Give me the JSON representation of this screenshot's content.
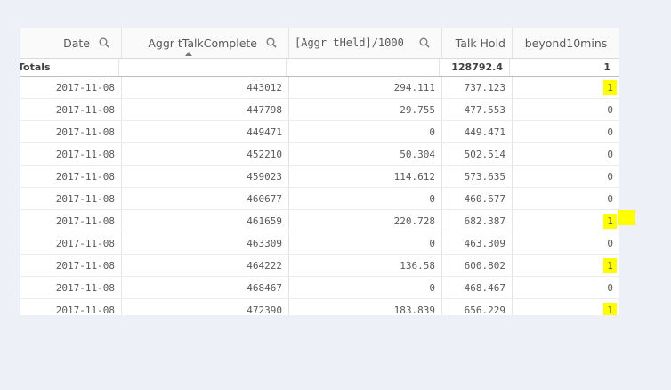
{
  "headers": {
    "date": "Date",
    "talk_complete": "Aggr tTalkComplete",
    "held": "[Aggr tHeld]/1000",
    "talk_hold": "Talk Hold",
    "beyond": "beyond10mins"
  },
  "totals": {
    "label": "Totals",
    "date": "",
    "talk_complete": "",
    "held": "",
    "talk_hold": "128792.4",
    "beyond": "1"
  },
  "rows": [
    {
      "date": "2017-11-08",
      "talk_complete": "443012",
      "held": "294.111",
      "talk_hold": "737.123",
      "beyond": "1",
      "highlight": true
    },
    {
      "date": "2017-11-08",
      "talk_complete": "447798",
      "held": "29.755",
      "talk_hold": "477.553",
      "beyond": "0",
      "highlight": false
    },
    {
      "date": "2017-11-08",
      "talk_complete": "449471",
      "held": "0",
      "talk_hold": "449.471",
      "beyond": "0",
      "highlight": false
    },
    {
      "date": "2017-11-08",
      "talk_complete": "452210",
      "held": "50.304",
      "talk_hold": "502.514",
      "beyond": "0",
      "highlight": false
    },
    {
      "date": "2017-11-08",
      "talk_complete": "459023",
      "held": "114.612",
      "talk_hold": "573.635",
      "beyond": "0",
      "highlight": false
    },
    {
      "date": "2017-11-08",
      "talk_complete": "460677",
      "held": "0",
      "talk_hold": "460.677",
      "beyond": "0",
      "highlight": false
    },
    {
      "date": "2017-11-08",
      "talk_complete": "461659",
      "held": "220.728",
      "talk_hold": "682.387",
      "beyond": "1",
      "highlight": true
    },
    {
      "date": "2017-11-08",
      "talk_complete": "463309",
      "held": "0",
      "talk_hold": "463.309",
      "beyond": "0",
      "highlight": false
    },
    {
      "date": "2017-11-08",
      "talk_complete": "464222",
      "held": "136.58",
      "talk_hold": "600.802",
      "beyond": "1",
      "highlight": true
    },
    {
      "date": "2017-11-08",
      "talk_complete": "468467",
      "held": "0",
      "talk_hold": "468.467",
      "beyond": "0",
      "highlight": false
    },
    {
      "date": "2017-11-08",
      "talk_complete": "472390",
      "held": "183.839",
      "talk_hold": "656.229",
      "beyond": "1",
      "highlight": true
    }
  ],
  "colors": {
    "highlight": "#ffff00",
    "background": "#edf0f7"
  }
}
